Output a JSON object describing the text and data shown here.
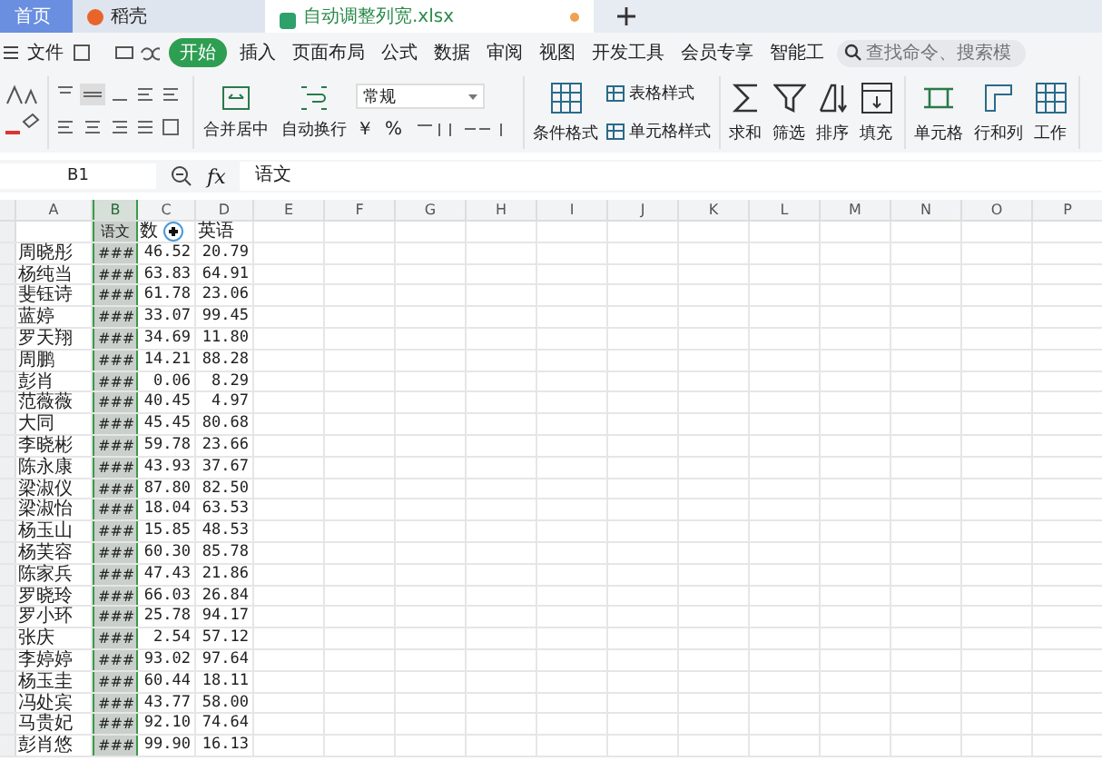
{
  "tabs": [
    {
      "label": "首页",
      "selected": false,
      "kind": "home",
      "unsaved": false
    },
    {
      "label": "稻壳",
      "selected": false,
      "kind": "docer",
      "unsaved": false
    },
    {
      "label": "自动调整列宽.xlsx",
      "selected": true,
      "kind": "sheet",
      "unsaved": true
    }
  ],
  "menu": {
    "file": "文件",
    "tabs": [
      {
        "label": "开始",
        "selected": true
      },
      {
        "label": "插入",
        "selected": false
      },
      {
        "label": "页面布局",
        "selected": false
      },
      {
        "label": "公式",
        "selected": false
      },
      {
        "label": "数据",
        "selected": false
      },
      {
        "label": "审阅",
        "selected": false
      },
      {
        "label": "视图",
        "selected": false
      },
      {
        "label": "开发工具",
        "selected": false
      },
      {
        "label": "会员专享",
        "selected": false
      },
      {
        "label": "智能工",
        "selected": false
      }
    ],
    "search_placeholder": "查找命令、搜索模"
  },
  "ribbon": {
    "merge": "合并居中",
    "wrap": "自动换行",
    "number_format": "常规",
    "currency": "￥",
    "percent": "%",
    "groups": [
      [
        {
          "kind": "big",
          "label": "条件格式"
        },
        {
          "kind": "stack",
          "items": [
            "表格样式",
            "单元格样式"
          ]
        }
      ],
      [
        {
          "kind": "big",
          "label": "求和"
        },
        {
          "kind": "big",
          "label": "筛选"
        },
        {
          "kind": "big",
          "label": "排序"
        },
        {
          "kind": "big",
          "label": "填充"
        }
      ],
      [
        {
          "kind": "big",
          "label": "单元格"
        },
        {
          "kind": "big",
          "label": "行和列"
        },
        {
          "kind": "big",
          "label": "工作"
        }
      ]
    ]
  },
  "formula_bar": {
    "cell_ref": "B1",
    "function_label": "fx",
    "content": "语文"
  },
  "sheet": {
    "columns": [
      {
        "label": "A",
        "selected": false
      },
      {
        "label": "B",
        "selected": true
      },
      {
        "label": "C",
        "selected": false
      },
      {
        "label": "D",
        "selected": false
      },
      {
        "label": "E",
        "selected": false
      },
      {
        "label": "F",
        "selected": false
      },
      {
        "label": "G",
        "selected": false
      },
      {
        "label": "H",
        "selected": false
      },
      {
        "label": "I",
        "selected": false
      },
      {
        "label": "J",
        "selected": false
      },
      {
        "label": "K",
        "selected": false
      },
      {
        "label": "L",
        "selected": false
      },
      {
        "label": "M",
        "selected": false
      },
      {
        "label": "N",
        "selected": false
      },
      {
        "label": "O",
        "selected": false
      },
      {
        "label": "P",
        "selected": false
      }
    ],
    "rows": [
      [
        "",
        "语文",
        "数",
        "英语"
      ],
      [
        "周晓彤",
        "###",
        "46.52",
        "20.79"
      ],
      [
        "杨纯当",
        "###",
        "63.83",
        "64.91"
      ],
      [
        "斐钰诗",
        "###",
        "61.78",
        "23.06"
      ],
      [
        "蓝婷",
        "###",
        "33.07",
        "99.45"
      ],
      [
        "罗天翔",
        "###",
        "34.69",
        "11.80"
      ],
      [
        "周鹏",
        "###",
        "14.21",
        "88.28"
      ],
      [
        "彭肖",
        "###",
        "0.06",
        "8.29"
      ],
      [
        "范薇薇",
        "###",
        "40.45",
        "4.97"
      ],
      [
        "大同",
        "###",
        "45.45",
        "80.68"
      ],
      [
        "李晓彬",
        "###",
        "59.78",
        "23.66"
      ],
      [
        "陈永康",
        "###",
        "43.93",
        "37.67"
      ],
      [
        "梁淑仪",
        "###",
        "87.80",
        "82.50"
      ],
      [
        "梁淑怡",
        "###",
        "18.04",
        "63.53"
      ],
      [
        "杨玉山",
        "###",
        "15.85",
        "48.53"
      ],
      [
        "杨芙容",
        "###",
        "60.30",
        "85.78"
      ],
      [
        "陈家兵",
        "###",
        "47.43",
        "21.86"
      ],
      [
        "罗晓玲",
        "###",
        "66.03",
        "26.84"
      ],
      [
        "罗小环",
        "###",
        "25.78",
        "94.17"
      ],
      [
        "张庆",
        "###",
        "2.54",
        "57.12"
      ],
      [
        "李婷婷",
        "###",
        "93.02",
        "97.64"
      ],
      [
        "杨玉圭",
        "###",
        "60.44",
        "18.11"
      ],
      [
        "冯处宾",
        "###",
        "43.77",
        "58.00"
      ],
      [
        "马贵妃",
        "###",
        "92.10",
        "74.64"
      ],
      [
        "彭肖悠",
        "###",
        "99.90",
        "16.13"
      ]
    ]
  }
}
